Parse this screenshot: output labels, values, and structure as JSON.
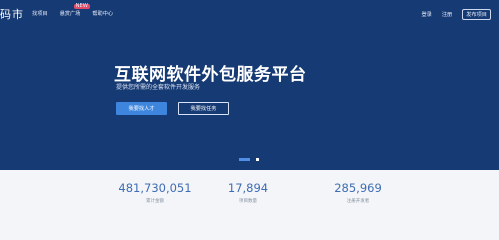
{
  "header": {
    "logo_text": "码市",
    "nav": [
      "找项目",
      "悬赏广场",
      "帮助中心"
    ],
    "nav_badge": "NEW",
    "login": "登录",
    "register": "注册",
    "publish": "发布项目"
  },
  "hero": {
    "title": "互联网软件外包服务平台",
    "subtitle": "提供您所需的全套软件开发服务",
    "primary_button": "我要找人才",
    "secondary_button": "我要找任务",
    "carousel_index": 1,
    "carousel_count": 2
  },
  "stats": [
    {
      "value": "481,730,051",
      "label": "累计金额"
    },
    {
      "value": "17,894",
      "label": "项目数量"
    },
    {
      "value": "285,969",
      "label": "注册开发者"
    }
  ],
  "colors": {
    "hero_bg": "#163a73",
    "accent": "#3d85dd",
    "stat_number": "#3f6db3"
  }
}
